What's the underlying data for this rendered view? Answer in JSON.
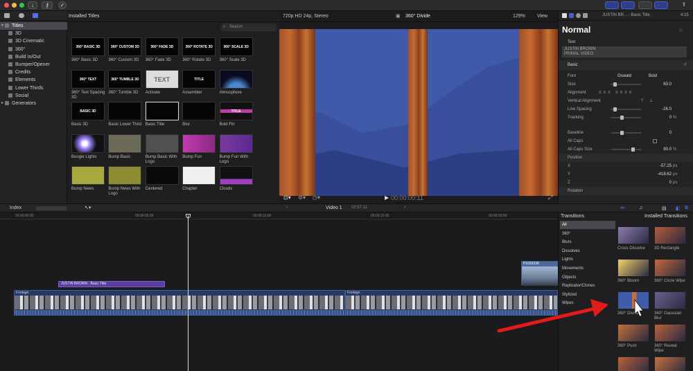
{
  "toolbar": {
    "traffic_lights": [
      "#fc5753",
      "#fdbc40",
      "#33c748"
    ],
    "download_glyph": "↓",
    "key_glyph": "⚷",
    "check_glyph": "✓",
    "right_share_glyph": "⇪"
  },
  "sidebar": {
    "items": [
      {
        "label": "Titles",
        "selected": true,
        "expanded": true
      },
      {
        "label": "3D"
      },
      {
        "label": "3D Cinematic"
      },
      {
        "label": "360°"
      },
      {
        "label": "Build In/Out"
      },
      {
        "label": "Bumper/Opener"
      },
      {
        "label": "Credits"
      },
      {
        "label": "Elements"
      },
      {
        "label": "Lower Thirds"
      },
      {
        "label": "Social"
      },
      {
        "label": "Generators"
      }
    ]
  },
  "browser": {
    "header": "Installed Titles",
    "search_placeholder": "Search",
    "tiles": [
      {
        "label": "360° Basic 3D",
        "thumb": "360° BASIC 3D"
      },
      {
        "label": "360° Custom 3D",
        "thumb": "360° CUSTOM 3D"
      },
      {
        "label": "360° Fade 3D",
        "thumb": "360° FADE 3D"
      },
      {
        "label": "360° Rotate 3D",
        "thumb": "360° ROTATE 3D"
      },
      {
        "label": "360° Scale 3D",
        "thumb": "360° SCALE 3D"
      },
      {
        "label": "360° Text Spacing 3D",
        "thumb": "360° TEXT SPACING 3D"
      },
      {
        "label": "360° Tumble 3D",
        "thumb": "360° TUMBLE 3D"
      },
      {
        "label": "Activate",
        "thumb": "TEXT"
      },
      {
        "label": "Assembler",
        "thumb": "TITLE"
      },
      {
        "label": "Atmosphere",
        "thumb": ""
      },
      {
        "label": "Basic 3D",
        "thumb": "BASIC 3D"
      },
      {
        "label": "Basic Lower Third",
        "thumb": ""
      },
      {
        "label": "Basic Title",
        "thumb": "",
        "selected": true
      },
      {
        "label": "Blur",
        "thumb": ""
      },
      {
        "label": "Bold Fin",
        "thumb": "TITLE"
      },
      {
        "label": "Boogie Lights",
        "thumb": ""
      },
      {
        "label": "Bump Basic",
        "thumb": ""
      },
      {
        "label": "Bump Basic With Logo",
        "thumb": ""
      },
      {
        "label": "Bump Fun",
        "thumb": ""
      },
      {
        "label": "Bump Fun With Logo",
        "thumb": ""
      },
      {
        "label": "Bump News",
        "thumb": ""
      },
      {
        "label": "Bump News With Logo",
        "thumb": ""
      },
      {
        "label": "Centered",
        "thumb": ""
      },
      {
        "label": "Chapter",
        "thumb": ""
      },
      {
        "label": "Clouds",
        "thumb": ""
      }
    ]
  },
  "viewer": {
    "format": "720p HD 24p, Stereo",
    "clip_name": "360° Divide",
    "zoom": "129%",
    "view_label": "View",
    "timecode": "00:00:00:11"
  },
  "inspector": {
    "clip_title": "JUSTIN BR... - Basic Title",
    "duration": "4:15",
    "style": "Normal",
    "text_section": "Text",
    "text_lines": [
      "JUSTIN BROWN",
      "PRIMAL VIDEO"
    ],
    "basic_section": "Basic",
    "font_label": "Font",
    "font_value": "Oswald",
    "weight_value": "Bold",
    "rows": [
      {
        "label": "Size",
        "value": "63.0",
        "unit": ""
      },
      {
        "label": "Alignment",
        "value": "",
        "unit": ""
      },
      {
        "label": "Vertical Alignment",
        "value": "",
        "unit": ""
      },
      {
        "label": "Line Spacing",
        "value": "-26.0",
        "unit": ""
      },
      {
        "label": "Tracking",
        "value": "0",
        "unit": "%"
      },
      {
        "label": "Baseline",
        "value": "0",
        "unit": ""
      },
      {
        "label": "All Caps",
        "value": "",
        "unit": ""
      },
      {
        "label": "All Caps Size",
        "value": "80.0",
        "unit": "%"
      },
      {
        "label": "Position",
        "value": "",
        "unit": ""
      },
      {
        "label": "X",
        "value": "-57.25",
        "unit": "px"
      },
      {
        "label": "Y",
        "value": "-418.62",
        "unit": "px"
      },
      {
        "label": "Z",
        "value": "0",
        "unit": "px"
      },
      {
        "label": "Rotation",
        "value": "",
        "unit": ""
      }
    ]
  },
  "timeline_bar": {
    "index_label": "Index",
    "project": "Video 1",
    "duration": "02:57:11"
  },
  "timeline": {
    "ruler": [
      "00:00:00:00",
      "00:00:05:00",
      "00:00:10:00",
      "00:00:15:00",
      "00:00:20:00"
    ],
    "title_clip": "JUSTIN BROWN - Basic Title",
    "clip_label_1": "Footage",
    "clip_label_2": "Footage",
    "clip_label_3": "P1033238"
  },
  "transitions": {
    "header": "Transitions",
    "installed": "Installed Transitions",
    "categories": [
      {
        "label": "All",
        "selected": true
      },
      {
        "label": "360°"
      },
      {
        "label": "Blurs"
      },
      {
        "label": "Dissolves"
      },
      {
        "label": "Lights"
      },
      {
        "label": "Movements"
      },
      {
        "label": "Objects"
      },
      {
        "label": "Replicator/Clones"
      },
      {
        "label": "Stylized"
      },
      {
        "label": "Wipes"
      }
    ],
    "tiles": [
      {
        "label": "Cross Dissolve",
        "color": "#8c7cae"
      },
      {
        "label": "3D Rectangle",
        "color": "#b55b3a"
      },
      {
        "label": "360° Bloom",
        "color": "#f2d26c"
      },
      {
        "label": "360° Circle Wipe",
        "color": "#c4683c"
      },
      {
        "label": "360° Divide",
        "color": "#3f5ca8"
      },
      {
        "label": "360° Gaussian Blur",
        "color": "#6d6090"
      },
      {
        "label": "360° Push",
        "color": "#c5703c"
      },
      {
        "label": "360° Reveal Wipe",
        "color": "#b8623a"
      },
      {
        "label": "",
        "color": "#b8623a"
      },
      {
        "label": "",
        "color": "#c5703c"
      }
    ]
  },
  "colors": {
    "accent": "#4a5fc4",
    "title_clip": "#5b3ea0",
    "video_clip": "#243a64",
    "arrow": "#e31b1b"
  }
}
